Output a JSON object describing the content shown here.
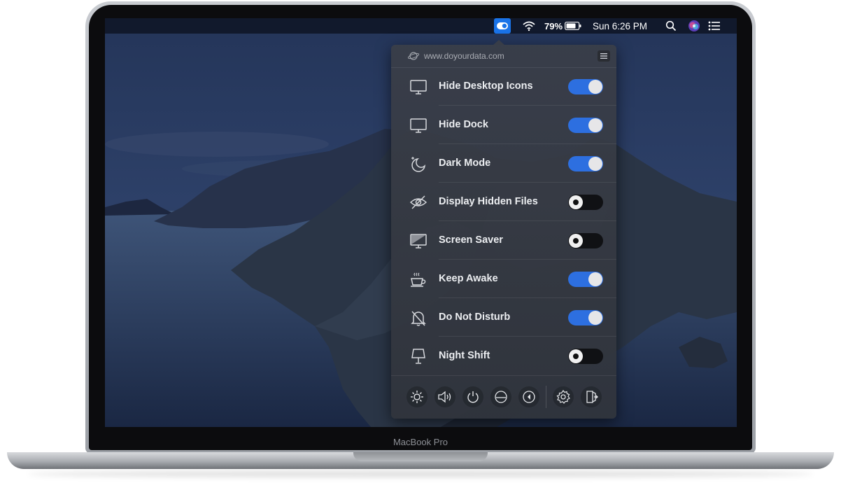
{
  "device": {
    "label": "MacBook Pro"
  },
  "menubar": {
    "battery": "79%",
    "clock": "Sun 6:26 PM"
  },
  "panel": {
    "url": "www.doyourdata.com",
    "items": [
      {
        "label": "Hide Desktop Icons",
        "icon": "monitor-icon",
        "on": true
      },
      {
        "label": "Hide Dock",
        "icon": "monitor-icon",
        "on": true
      },
      {
        "label": "Dark Mode",
        "icon": "moon-icon",
        "on": true
      },
      {
        "label": "Display Hidden Files",
        "icon": "eye-slash-icon",
        "on": false
      },
      {
        "label": "Screen Saver",
        "icon": "screen-saver-icon",
        "on": false
      },
      {
        "label": "Keep Awake",
        "icon": "coffee-cup-icon",
        "on": true
      },
      {
        "label": "Do Not Disturb",
        "icon": "bell-slash-icon",
        "on": true
      },
      {
        "label": "Night Shift",
        "icon": "lamp-icon",
        "on": false
      }
    ],
    "bottom_buttons": [
      "brightness-icon",
      "volume-icon",
      "power-icon",
      "eject-icon",
      "back-icon",
      "settings-gear-icon",
      "exit-icon"
    ]
  },
  "colors": {
    "toggle_on": "#2d6fe0",
    "toggle_off": "#101114",
    "app_icon": "#1a73e8"
  }
}
